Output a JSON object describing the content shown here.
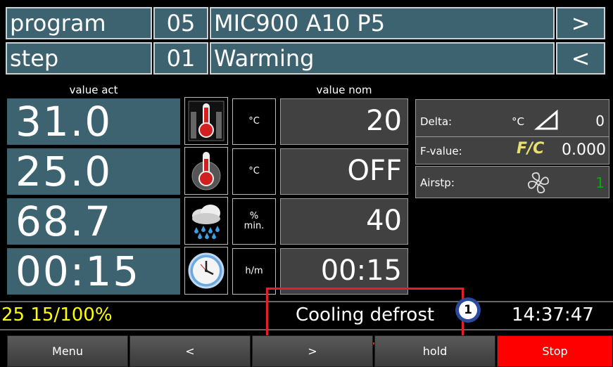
{
  "header": {
    "program_label": "program",
    "program_no": "05",
    "program_name": "MIC900 A10 P5",
    "next": ">",
    "step_label": "step",
    "step_no": "01",
    "step_name": "Warming",
    "prev": "<"
  },
  "columns": {
    "actual_label": "value act",
    "nominal_label": "value nom"
  },
  "rows": [
    {
      "actual": "31.0",
      "unit": "°C",
      "nominal": "20",
      "icon": "air-thermometer-icon"
    },
    {
      "actual": "25.0",
      "unit": "°C",
      "nominal": "OFF",
      "icon": "core-thermometer-icon"
    },
    {
      "actual": "68.7",
      "unit": "%\nmin.",
      "nominal": "40",
      "icon": "rain-cloud-icon"
    },
    {
      "actual": "00:15",
      "unit": "h/m",
      "nominal": "00:15",
      "icon": "clock-icon"
    }
  ],
  "side_panel": {
    "delta_label": "Delta:",
    "delta_unit": "°C",
    "delta_value": "0",
    "fvalue_label": "F-value:",
    "fvalue_badge": "F/C",
    "fvalue_value": "0.000",
    "airstep_label": "Airstp:",
    "airstep_value": "1"
  },
  "status": {
    "left": "25 15/100%",
    "message": "Cooling defrost",
    "callout": "1",
    "time": "14:37:47"
  },
  "buttons": {
    "menu": "Menu",
    "back": "<",
    "forward": ">",
    "hold": "hold",
    "stop": "Stop"
  },
  "colors": {
    "panel_teal": "#3d6270",
    "panel_grey": "#414141",
    "status_yellow": "#ffff00",
    "airstep_green": "#00b000",
    "stop_red": "#ff0000",
    "annotation_red": "#e0202a"
  }
}
